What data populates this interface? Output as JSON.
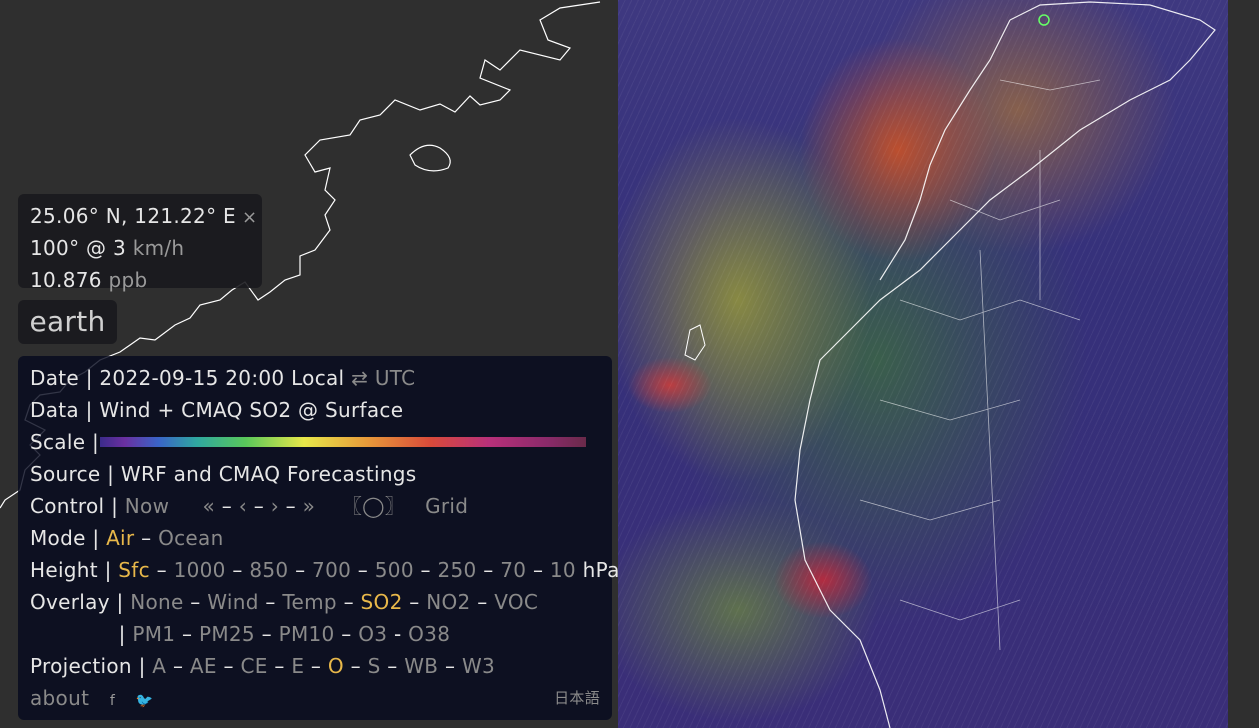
{
  "spot": {
    "coords": "25.06° N, 121.22° E",
    "close_icon": "×",
    "wind_value": "100° @ 3",
    "wind_unit": "km/h",
    "overlay_value": "10.876",
    "overlay_unit": "ppb"
  },
  "app_title": "earth",
  "menu": {
    "date": {
      "label": "Date",
      "value": "2022-09-15 20:00 Local",
      "toggle_icon": "⇄",
      "toggle": "UTC"
    },
    "data": {
      "label": "Data",
      "value": "Wind + CMAQ SO2 @ Surface"
    },
    "scale": {
      "label": "Scale"
    },
    "source": {
      "label": "Source",
      "value": "WRF and CMAQ Forecastings"
    },
    "control": {
      "label": "Control",
      "now": "Now",
      "first": "«",
      "prev": "‹",
      "next": "›",
      "last": "»",
      "locate": "〖◯〗",
      "grid": "Grid"
    },
    "mode": {
      "label": "Mode",
      "options": [
        "Air",
        "Ocean"
      ],
      "selected": "Air"
    },
    "height": {
      "label": "Height",
      "options": [
        "Sfc",
        "1000",
        "850",
        "700",
        "500",
        "250",
        "70",
        "10"
      ],
      "unit": "hPa",
      "selected": "Sfc"
    },
    "overlay": {
      "label": "Overlay",
      "options_row1": [
        "None",
        "Wind",
        "Temp",
        "SO2",
        "NO2",
        "VOC"
      ],
      "options_row2": [
        "PM1",
        "PM25",
        "PM10",
        "O3",
        "O38"
      ],
      "selected": "SO2"
    },
    "projection": {
      "label": "Projection",
      "options": [
        "A",
        "AE",
        "CE",
        "E",
        "O",
        "S",
        "WB",
        "W3"
      ],
      "selected": "O"
    },
    "footer": {
      "about": "about",
      "facebook_icon": "f",
      "twitter_icon": "🐦",
      "language": "日本語"
    }
  },
  "colors": {
    "selected": "#e8b84a",
    "option": "#8a8a8a",
    "panel_bg": "#060a1e"
  }
}
